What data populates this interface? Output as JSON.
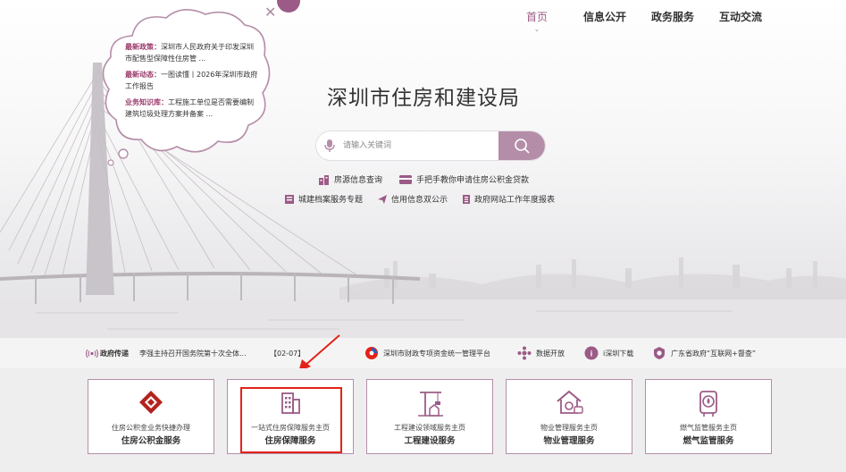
{
  "nav": {
    "items": [
      {
        "label": "首页",
        "active": true
      },
      {
        "label": "信息公开",
        "active": false
      },
      {
        "label": "政务服务",
        "active": false
      },
      {
        "label": "互动交流",
        "active": false
      }
    ]
  },
  "cloud": {
    "news": [
      {
        "tag": "最新政策：",
        "text": "深圳市人民政府关于印发深圳市配售型保障性住房管 ..."
      },
      {
        "tag": "最新动态：",
        "text": "一图读懂丨2026年深圳市政府工作报告"
      },
      {
        "tag": "业务知识库：",
        "text": "工程施工单位是否需要编制建筑垃圾处理方案并备案 ..."
      }
    ],
    "close_glyph": "✕"
  },
  "site_title": "深圳市住房和建设局",
  "search": {
    "placeholder": "请输入关键词"
  },
  "quick_links_row1": [
    {
      "label": "房源信息查询",
      "icon": "building-chart-icon"
    },
    {
      "label": "手把手教你申请住房公积金贷款",
      "icon": "card-icon"
    }
  ],
  "quick_links_row2": [
    {
      "label": "城建档案服务专题",
      "icon": "archive-icon"
    },
    {
      "label": "信用信息双公示",
      "icon": "paper-plane-icon"
    },
    {
      "label": "政府网站工作年度报表",
      "icon": "report-icon"
    }
  ],
  "ticker": {
    "label": "政府传递",
    "headline": "李强主持召开国务院第十次全体...",
    "date": "【02-07】",
    "links": [
      {
        "label": "深圳市财政专项资金统一管理平台",
        "icon": "finance-logo-icon"
      },
      {
        "label": "数据开放",
        "icon": "data-open-icon"
      },
      {
        "label": "i深圳下载",
        "icon": "i-shenzhen-icon"
      },
      {
        "label": "广东省政府“互联网+督查”",
        "icon": "supervision-icon"
      }
    ]
  },
  "cards": [
    {
      "sub": "住房公积金业务快捷办理",
      "main": "住房公积金服务",
      "icon": "housing-fund-icon"
    },
    {
      "sub": "一站式住房保障服务主页",
      "main": "住房保障服务",
      "icon": "housing-security-icon"
    },
    {
      "sub": "工程建设领域服务主页",
      "main": "工程建设服务",
      "icon": "construction-crane-icon"
    },
    {
      "sub": "物业管理服务主页",
      "main": "物业管理服务",
      "icon": "property-house-icon"
    },
    {
      "sub": "燃气监管服务主页",
      "main": "燃气监管服务",
      "icon": "gas-meter-icon"
    }
  ],
  "colors": {
    "accent": "#9b5b86",
    "search_button": "#b48ea8",
    "card_border": "#b48ea8",
    "highlight_red": "#e2231a"
  }
}
